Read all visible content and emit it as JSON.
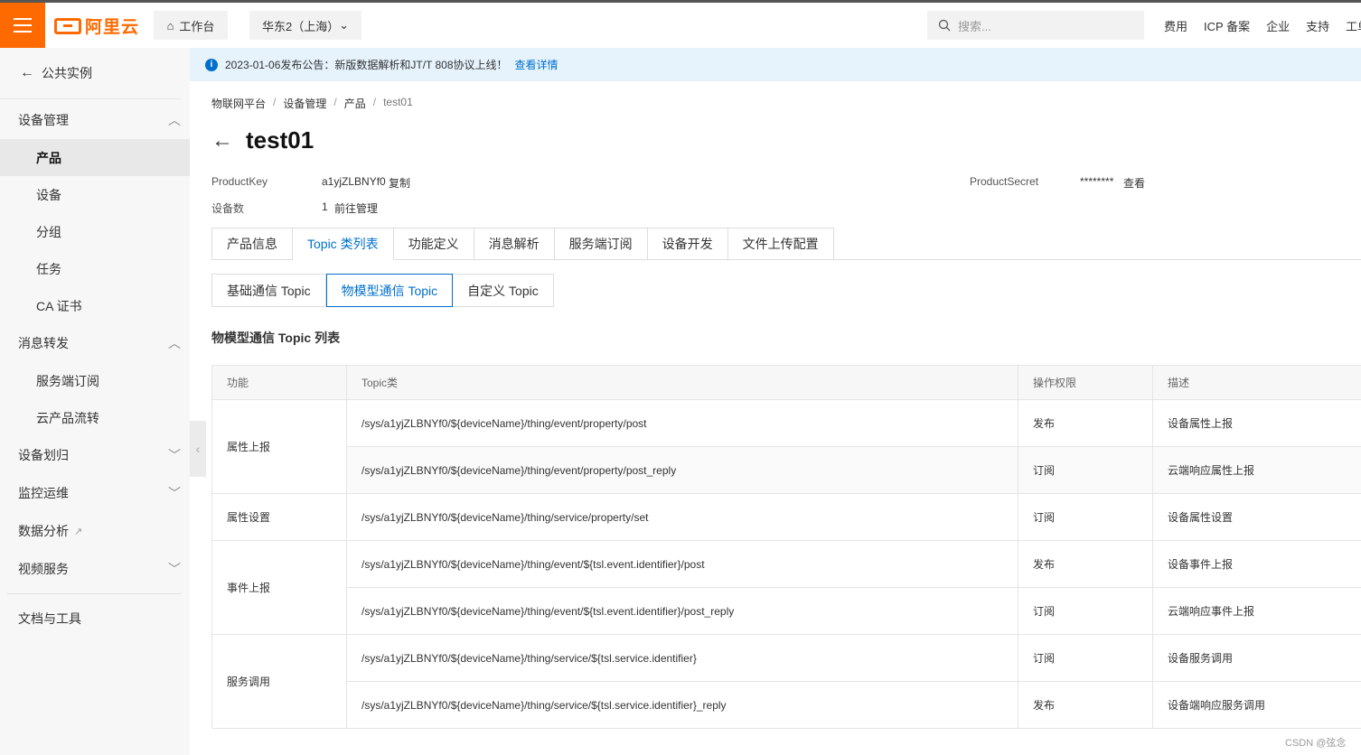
{
  "topbar": {
    "logo_text": "阿里云",
    "workbench": "工作台",
    "region": "华东2（上海）",
    "search_placeholder": "搜索...",
    "nav": [
      "费用",
      "ICP 备案",
      "企业",
      "支持",
      "工单"
    ]
  },
  "sidebar": {
    "back_label": "公共实例",
    "groups": {
      "device_mgmt": "设备管理",
      "msg_forward": "消息转发",
      "device_assign": "设备划归",
      "monitor_ops": "监控运维",
      "data_analysis": "数据分析",
      "video_service": "视频服务",
      "docs_tools": "文档与工具"
    },
    "items": {
      "product": "产品",
      "device": "设备",
      "group": "分组",
      "task": "任务",
      "ca_cert": "CA 证书",
      "server_sub": "服务端订阅",
      "cloud_flow": "云产品流转"
    }
  },
  "notice": {
    "text": "2023-01-06发布公告：新版数据解析和JT/T 808协议上线！",
    "link": "查看详情"
  },
  "breadcrumb": [
    "物联网平台",
    "设备管理",
    "产品",
    "test01"
  ],
  "title": "test01",
  "meta": {
    "productkey_label": "ProductKey",
    "productkey_value": "a1yjZLBNYf0",
    "copy_link": "复制",
    "device_count_label": "设备数",
    "device_count_value": "1",
    "manage_link": "前往管理",
    "productsecret_label": "ProductSecret",
    "productsecret_value": "********",
    "view_link": "查看"
  },
  "tabs": [
    "产品信息",
    "Topic 类列表",
    "功能定义",
    "消息解析",
    "服务端订阅",
    "设备开发",
    "文件上传配置"
  ],
  "active_tab": "Topic 类列表",
  "subtabs": [
    "基础通信 Topic",
    "物模型通信 Topic",
    "自定义 Topic"
  ],
  "active_subtab": "物模型通信 Topic",
  "section_title": "物模型通信 Topic 列表",
  "table": {
    "headers": [
      "功能",
      "Topic类",
      "操作权限",
      "描述"
    ],
    "groups": [
      {
        "func": "属性上报",
        "rows": [
          {
            "topic": "/sys/a1yjZLBNYf0/${deviceName}/thing/event/property/post",
            "perm": "发布",
            "desc": "设备属性上报"
          },
          {
            "topic": "/sys/a1yjZLBNYf0/${deviceName}/thing/event/property/post_reply",
            "perm": "订阅",
            "desc": "云端响应属性上报"
          }
        ]
      },
      {
        "func": "属性设置",
        "rows": [
          {
            "topic": "/sys/a1yjZLBNYf0/${deviceName}/thing/service/property/set",
            "perm": "订阅",
            "desc": "设备属性设置"
          }
        ]
      },
      {
        "func": "事件上报",
        "rows": [
          {
            "topic": "/sys/a1yjZLBNYf0/${deviceName}/thing/event/${tsl.event.identifier}/post",
            "perm": "发布",
            "desc": "设备事件上报"
          },
          {
            "topic": "/sys/a1yjZLBNYf0/${deviceName}/thing/event/${tsl.event.identifier}/post_reply",
            "perm": "订阅",
            "desc": "云端响应事件上报"
          }
        ]
      },
      {
        "func": "服务调用",
        "rows": [
          {
            "topic": "/sys/a1yjZLBNYf0/${deviceName}/thing/service/${tsl.service.identifier}",
            "perm": "订阅",
            "desc": "设备服务调用"
          },
          {
            "topic": "/sys/a1yjZLBNYf0/${deviceName}/thing/service/${tsl.service.identifier}_reply",
            "perm": "发布",
            "desc": "设备端响应服务调用"
          }
        ]
      }
    ]
  },
  "watermark": "CSDN @弦念",
  "colors": {
    "brand": "#ff6a00",
    "link": "#0070cc",
    "notice_bg": "#e6f3fd"
  }
}
